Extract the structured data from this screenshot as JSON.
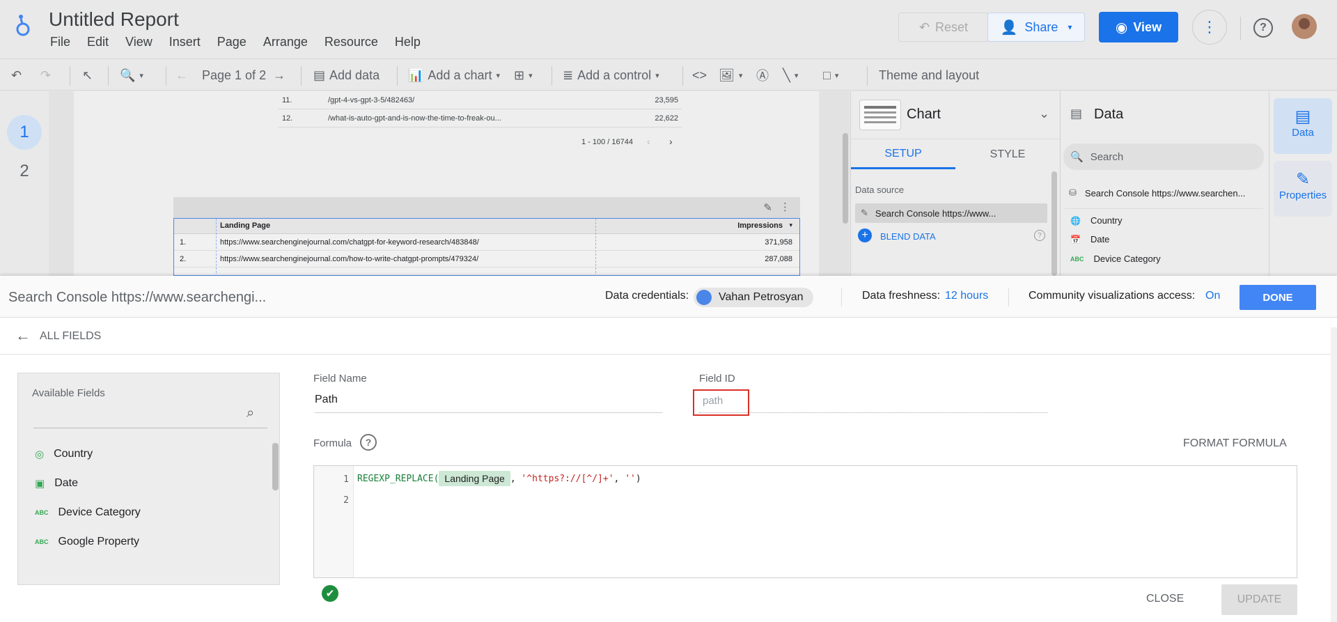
{
  "app": {
    "title": "Untitled Report",
    "menu": [
      "File",
      "Edit",
      "View",
      "Insert",
      "Page",
      "Arrange",
      "Resource",
      "Help"
    ],
    "reset_label": "Reset",
    "share_label": "Share",
    "view_label": "View"
  },
  "toolbar": {
    "page_label": "Page 1 of 2",
    "add_data": "Add data",
    "add_chart": "Add a chart",
    "add_control": "Add a control",
    "theme_layout": "Theme and layout"
  },
  "pages": [
    "1",
    "2"
  ],
  "top_table": {
    "rows": [
      {
        "idx": "11.",
        "path": "/gpt-4-vs-gpt-3-5/482463/",
        "value": "23,595"
      },
      {
        "idx": "12.",
        "path": "/what-is-auto-gpt-and-is-now-the-time-to-freak-ou...",
        "value": "22,622"
      }
    ],
    "pager": "1 - 100 / 16744"
  },
  "main_table": {
    "col1": "Landing Page",
    "col2": "Impressions",
    "rows": [
      {
        "idx": "1.",
        "url": "https://www.searchenginejournal.com/chatgpt-for-keyword-research/483848/",
        "value": "371,958"
      },
      {
        "idx": "2.",
        "url": "https://www.searchenginejournal.com/how-to-write-chatgpt-prompts/479324/",
        "value": "287,088"
      }
    ]
  },
  "chart_panel": {
    "title": "Chart",
    "tab_setup": "SETUP",
    "tab_style": "STYLE",
    "data_source_label": "Data source",
    "data_source": "Search Console https://www...",
    "blend": "BLEND DATA"
  },
  "data_panel": {
    "title": "Data",
    "search_placeholder": "Search",
    "source": "Search Console https://www.searchen...",
    "fields": [
      "Country",
      "Date",
      "Device Category"
    ]
  },
  "side_tabs": {
    "data": "Data",
    "properties": "Properties"
  },
  "editor_bar": {
    "source": "Search Console https://www.searchengi...",
    "credentials_label": "Data credentials:",
    "credentials_user": "Vahan Petrosyan",
    "freshness_label": "Data freshness:",
    "freshness_value": "12 hours",
    "community_label": "Community visualizations access:",
    "community_value": "On",
    "done": "DONE"
  },
  "all_fields_label": "ALL FIELDS",
  "available": {
    "title": "Available Fields",
    "fields": [
      {
        "name": "Country",
        "type": "geo"
      },
      {
        "name": "Date",
        "type": "date"
      },
      {
        "name": "Device Category",
        "type": "text"
      },
      {
        "name": "Google Property",
        "type": "text"
      }
    ]
  },
  "field_form": {
    "name_label": "Field Name",
    "name_value": "Path",
    "id_label": "Field ID",
    "id_placeholder": "path",
    "formula_label": "Formula",
    "format_formula": "FORMAT FORMULA",
    "line1_func": "REGEXP_REPLACE(",
    "line1_field": "Landing Page",
    "line1_comma1": ", ",
    "line1_regex": "'^https?://[^/]+'",
    "line1_comma2": ", ",
    "line1_empty": "''",
    "line1_close": ")",
    "line_numbers": [
      "1",
      "2"
    ],
    "close": "CLOSE",
    "update": "UPDATE"
  },
  "colors": {
    "accent": "#1a73e8",
    "valid": "#1e8e3e",
    "highlight_box": "#d93025"
  }
}
